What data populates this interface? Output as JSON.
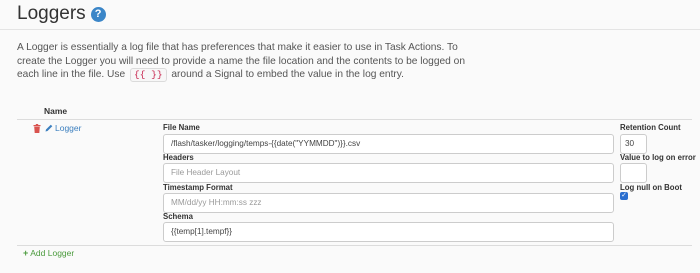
{
  "page": {
    "title": "Loggers",
    "help_icon": "question-circle-icon"
  },
  "description": {
    "before_code": "A Logger is essentially a log file that has preferences that make it easier to use in Task Actions. To create the Logger you will need to provide a name the file location and the contents to be logged on each line in the file. Use",
    "code": "{{ }}",
    "after_code": "around a Signal to embed the value in the log entry."
  },
  "table": {
    "name_header": "Name"
  },
  "logger": {
    "name": "Logger",
    "file_name_label": "File Name",
    "file_name_value": "/flash/tasker/logging/temps-{{date(\"YYMMDD\")}}.csv",
    "headers_label": "Headers",
    "headers_placeholder": "File Header Layout",
    "timestamp_label": "Timestamp Format",
    "timestamp_placeholder": "MM/dd/yy HH:mm:ss zzz",
    "schema_label": "Schema",
    "schema_value": "{{temp[1].tempf}}",
    "retention_label": "Retention Count",
    "retention_value": "30",
    "null_value_label": "Value to log on error",
    "null_value_value": "",
    "log_null_label": "Log null on Boot",
    "log_null_checked": true
  },
  "actions": {
    "add_logger": "Add Logger"
  },
  "colors": {
    "link": "#3b7fbf",
    "add": "#4a9a3c",
    "delete": "#d9534f",
    "help": "#3b86c8"
  }
}
